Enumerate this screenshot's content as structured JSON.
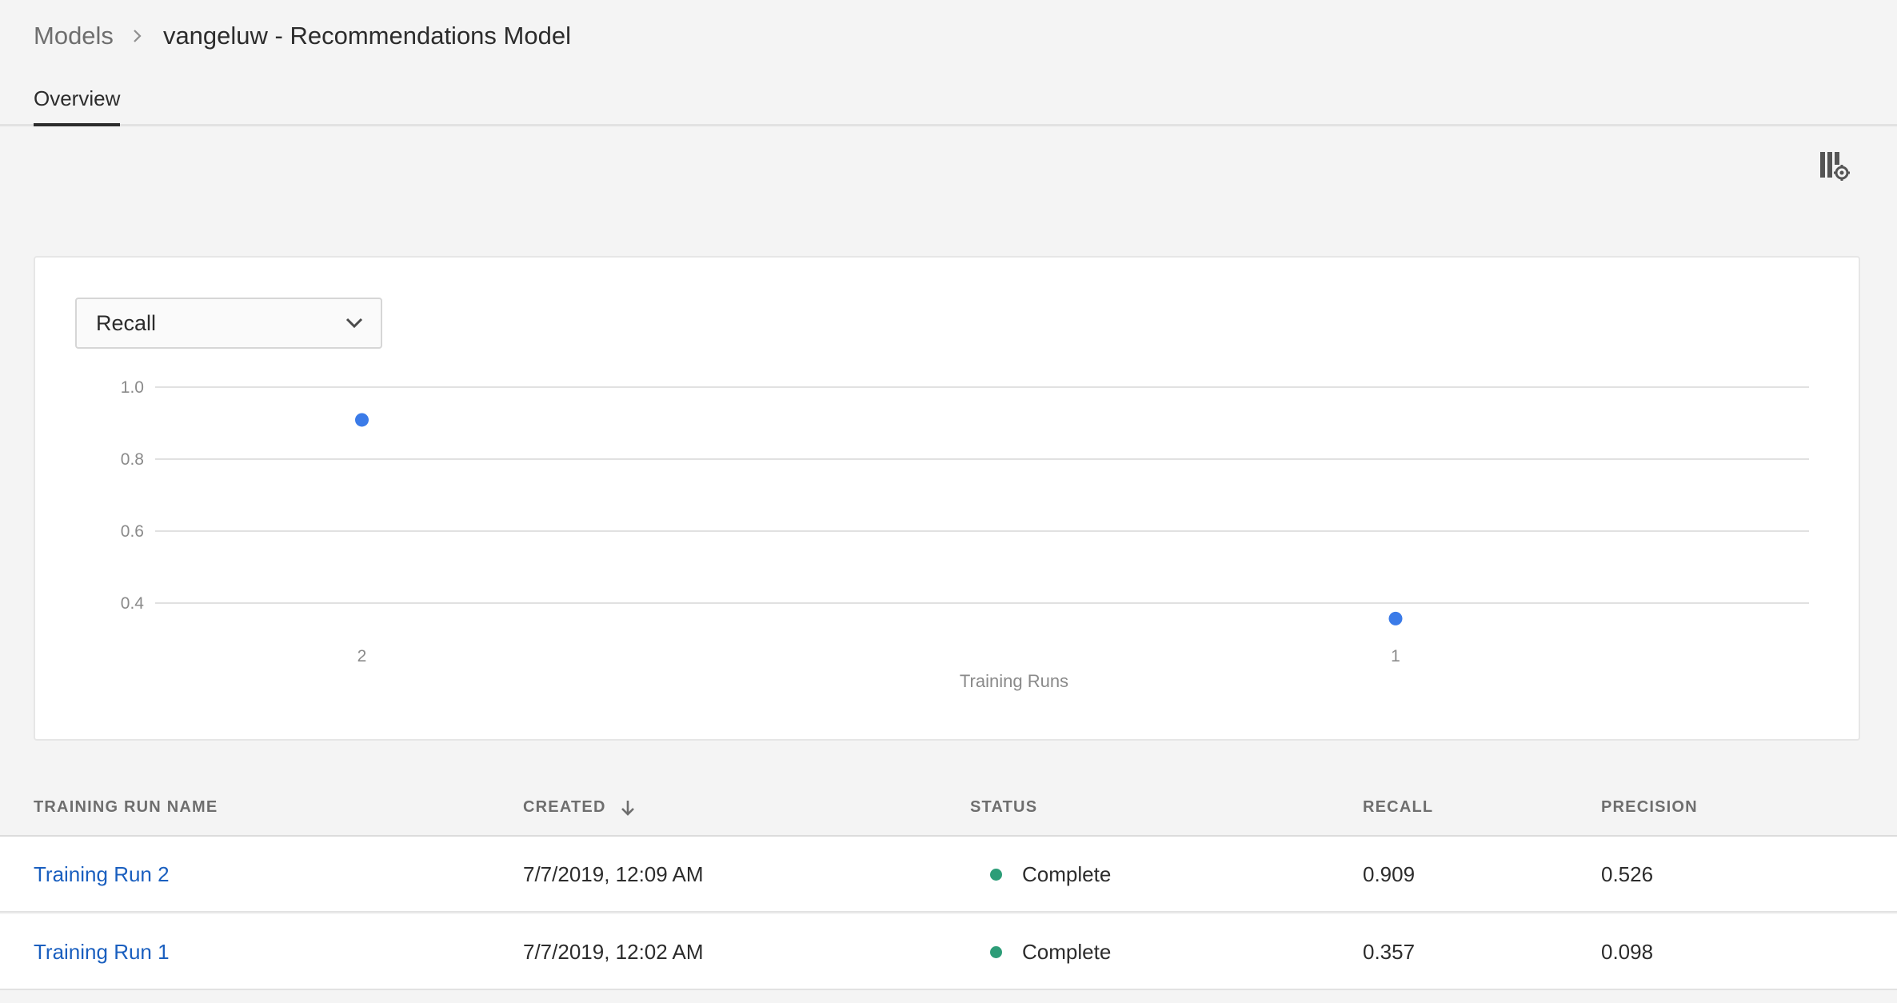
{
  "breadcrumb": {
    "root": "Models",
    "current": "vangeluw - Recommendations Model"
  },
  "tabs": [
    {
      "label": "Overview",
      "selected": true
    }
  ],
  "toolbar": {
    "settings_icon": "column-settings-icon"
  },
  "metric_select": {
    "selected": "Recall",
    "icon": "chevron-down-icon"
  },
  "chart_data": {
    "type": "scatter",
    "categories": [
      "2",
      "1"
    ],
    "series": [
      {
        "values": [
          0.909,
          0.357
        ]
      }
    ],
    "xlabel": "Training Runs",
    "ylabel": "",
    "yticks": [
      "1.0",
      "0.8",
      "0.6",
      "0.4"
    ],
    "ylim": [
      0.4,
      1.0
    ],
    "grid": true,
    "color": "#3b7be8"
  },
  "table": {
    "columns": [
      "TRAINING RUN NAME",
      "CREATED",
      "STATUS",
      "RECALL",
      "PRECISION"
    ],
    "sort_icon": "arrow-down-icon",
    "rows": [
      {
        "name": "Training Run 2",
        "created": "7/7/2019, 12:09 AM",
        "status": "Complete",
        "recall": "0.909",
        "precision": "0.526"
      },
      {
        "name": "Training Run 1",
        "created": "7/7/2019, 12:02 AM",
        "status": "Complete",
        "recall": "0.357",
        "precision": "0.098"
      }
    ]
  },
  "colors": {
    "status_complete": "#2d9d78",
    "link": "#1a5fbf",
    "point": "#3b7be8"
  }
}
